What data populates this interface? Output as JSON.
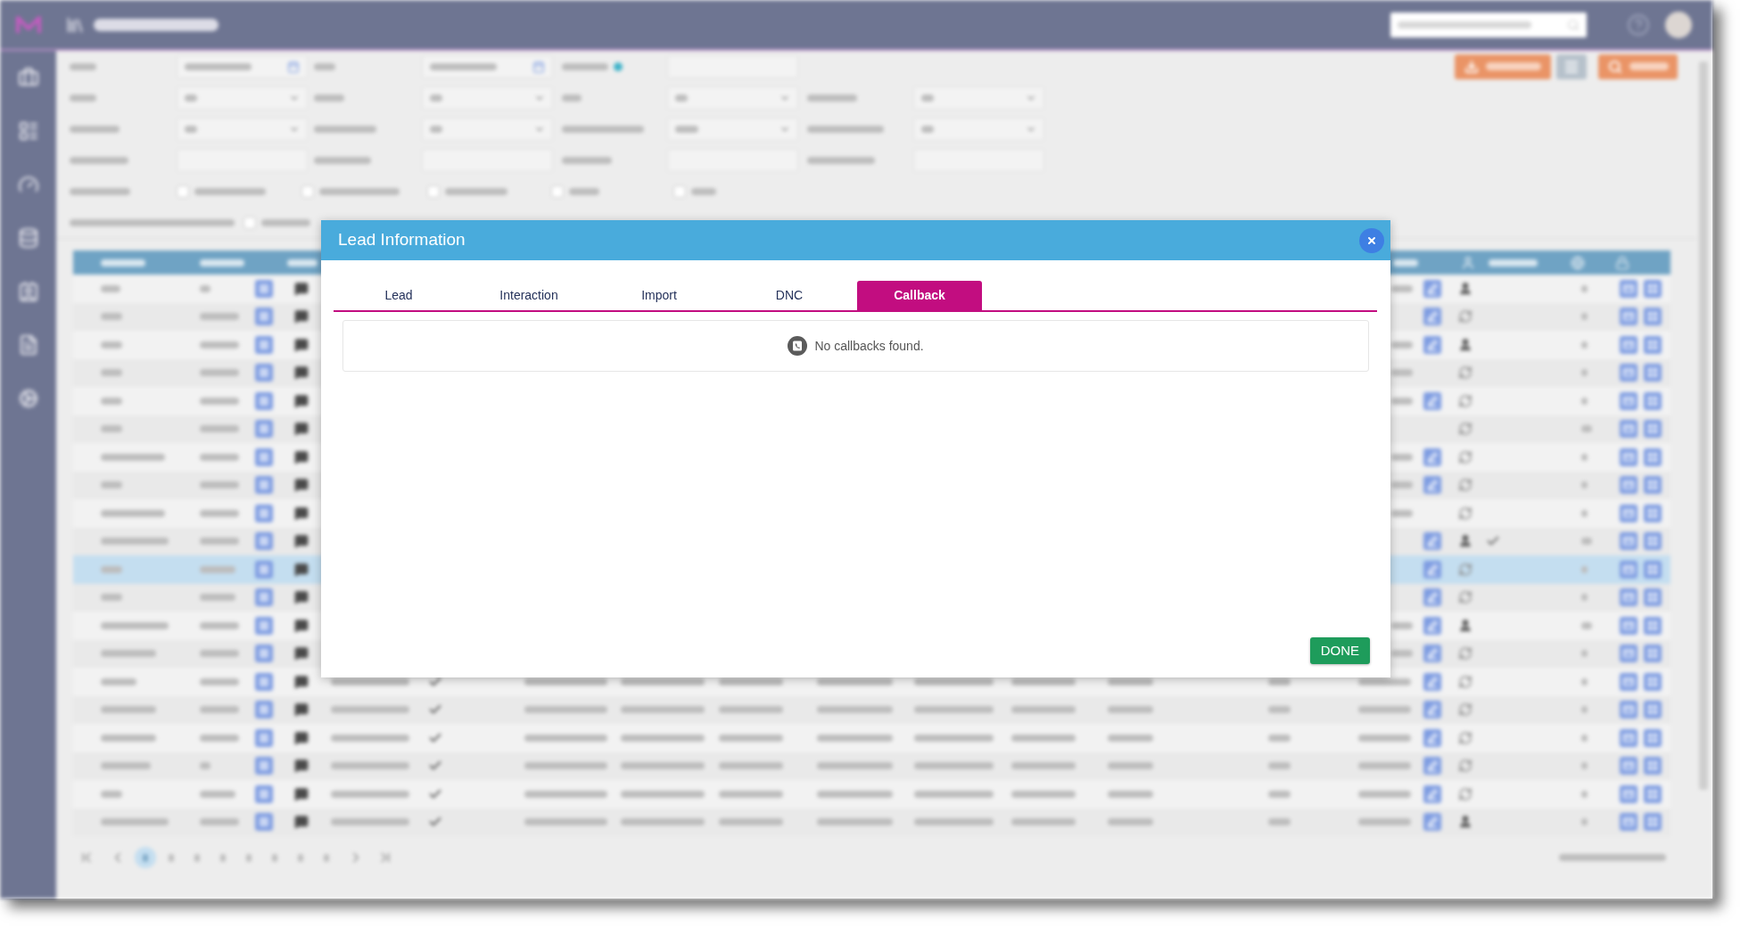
{
  "filters": {
    "checkboxes": [
      {
        "checked": false
      },
      {
        "checked": false
      },
      {
        "checked": false
      },
      {
        "checked": false
      },
      {
        "checked": false
      },
      {
        "checked": false
      }
    ]
  },
  "table": {
    "rows": [
      {
        "selected": false
      },
      {
        "selected": false
      },
      {
        "selected": false
      },
      {
        "selected": false
      },
      {
        "selected": false
      },
      {
        "selected": false
      },
      {
        "selected": false
      },
      {
        "selected": false
      },
      {
        "selected": false
      },
      {
        "selected": false
      },
      {
        "selected": true
      },
      {
        "selected": false
      },
      {
        "selected": false
      },
      {
        "selected": false
      },
      {
        "selected": false
      },
      {
        "selected": false
      },
      {
        "selected": false
      },
      {
        "selected": false
      },
      {
        "selected": false
      },
      {
        "selected": false
      }
    ]
  },
  "pager": {
    "pages": [
      {
        "selected": true
      },
      {
        "selected": false
      },
      {
        "selected": false
      },
      {
        "selected": false
      },
      {
        "selected": false
      },
      {
        "selected": false
      },
      {
        "selected": false
      },
      {
        "selected": false
      }
    ]
  },
  "dialog": {
    "title": "Lead Information",
    "tabs": [
      {
        "label": "Lead",
        "selected": false
      },
      {
        "label": "Interaction",
        "selected": false
      },
      {
        "label": "Import",
        "selected": false
      },
      {
        "label": "DNC",
        "selected": false
      },
      {
        "label": "Callback",
        "selected": true
      }
    ],
    "message": "No callbacks found.",
    "buttons": [
      "DONE"
    ]
  }
}
